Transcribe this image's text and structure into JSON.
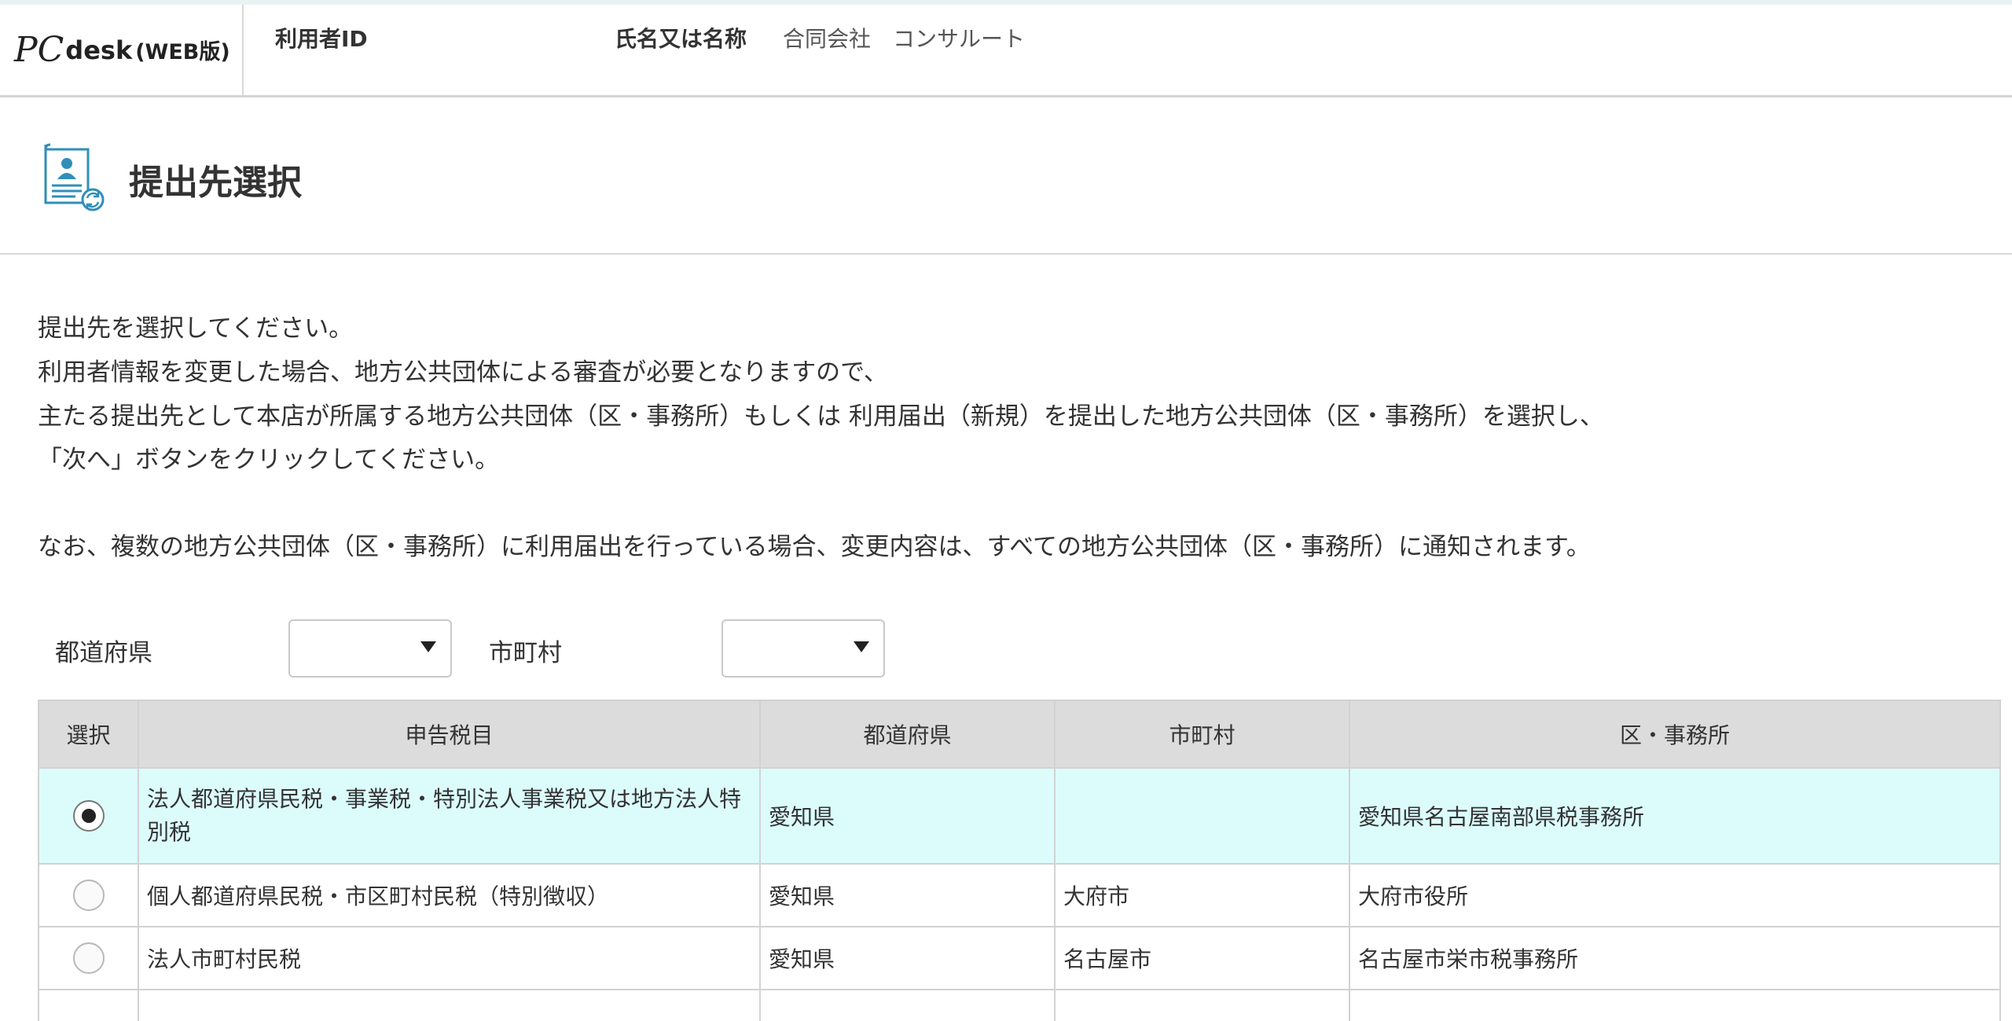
{
  "header": {
    "logo_pc": "PC",
    "logo_desk": "desk",
    "logo_web": "(WEB版)",
    "user_id_label": "利用者ID",
    "user_id_value": "",
    "name_label": "氏名又は名称",
    "name_value": "合同会社　コンサルート"
  },
  "page": {
    "title": "提出先選択",
    "icon": "document-user-refresh-icon"
  },
  "instructions": [
    "提出先を選択してください。",
    "利用者情報を変更した場合、地方公共団体による審査が必要となりますので、",
    "主たる提出先として本店が所属する地方公共団体（区・事務所）もしくは 利用届出（新規）を提出した地方公共団体（区・事務所）を選択し、",
    "「次へ」ボタンをクリックしてください。",
    "なお、複数の地方公共団体（区・事務所）に利用届出を行っている場合、変更内容は、すべての地方公共団体（区・事務所）に通知されます。"
  ],
  "filters": {
    "prefecture_label": "都道府県",
    "prefecture_value": "",
    "city_label": "市町村",
    "city_value": ""
  },
  "table": {
    "headers": [
      "選択",
      "申告税目",
      "都道府県",
      "市町村",
      "区・事務所"
    ],
    "rows": [
      {
        "selected": true,
        "tax": "法人都道府県民税・事業税・特別法人事業税又は地方法人特別税",
        "prefecture": "愛知県",
        "city": "",
        "office": "愛知県名古屋南部県税事務所"
      },
      {
        "selected": false,
        "tax": "個人都道府県民税・市区町村民税（特別徴収）",
        "prefecture": "愛知県",
        "city": "大府市",
        "office": "大府市役所"
      },
      {
        "selected": false,
        "tax": "法人市町村民税",
        "prefecture": "愛知県",
        "city": "名古屋市",
        "office": "名古屋市栄市税事務所"
      }
    ]
  },
  "colors": {
    "selected_row": "#dcfcfc",
    "header_bg": "#dcdcdc",
    "icon_blue": "#2f8fb8"
  }
}
